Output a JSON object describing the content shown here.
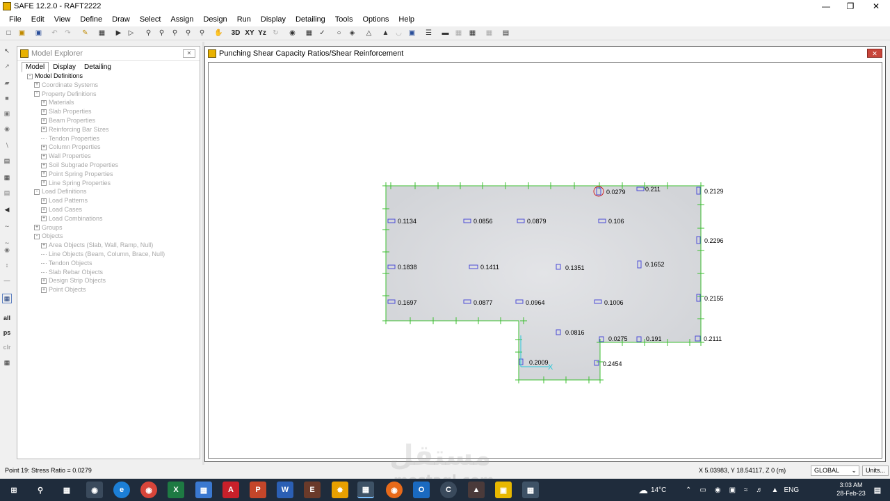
{
  "window": {
    "title": "SAFE 12.2.0 - RAFT2222",
    "minimize": "—",
    "maximize": "❐",
    "close": "✕"
  },
  "menu": [
    "File",
    "Edit",
    "View",
    "Define",
    "Draw",
    "Select",
    "Assign",
    "Design",
    "Run",
    "Display",
    "Detailing",
    "Tools",
    "Options",
    "Help"
  ],
  "toolbar": {
    "text_buttons": [
      "3D",
      "XY",
      "Yz"
    ],
    "icons": [
      "new-icon",
      "open-icon",
      "save-icon",
      "undo-icon",
      "redo-icon",
      "pencil-icon",
      "print-preview-icon",
      "run-icon",
      "run-all-icon",
      "zoom-window-icon",
      "zoom-fit-icon",
      "zoom-icon",
      "zoom-in-icon",
      "zoom-out-icon",
      "pan-icon",
      "rotate-icon",
      "view-icon",
      "check-icon",
      "circle-icon",
      "fill-icon",
      "triangle-icon",
      "tools-icon"
    ]
  },
  "left_tools": {
    "labels": [
      "all",
      "ps",
      "clr"
    ]
  },
  "explorer": {
    "title": "Model Explorer",
    "close": "✕",
    "tabs": [
      "Model",
      "Display",
      "Detailing"
    ],
    "active_tab": "Model",
    "tree": [
      {
        "label": "Model Definitions",
        "level": 0,
        "toggle": "-",
        "active": true
      },
      {
        "label": "Coordinate Systems",
        "level": 1,
        "toggle": "+"
      },
      {
        "label": "Property Definitions",
        "level": 1,
        "toggle": "-"
      },
      {
        "label": "Materials",
        "level": 2,
        "toggle": "+"
      },
      {
        "label": "Slab Properties",
        "level": 2,
        "toggle": "+"
      },
      {
        "label": "Beam Properties",
        "level": 2,
        "toggle": "+"
      },
      {
        "label": "Reinforcing Bar Sizes",
        "level": 2,
        "toggle": "+"
      },
      {
        "label": "Tendon Properties",
        "level": 2,
        "toggle": ""
      },
      {
        "label": "Column Properties",
        "level": 2,
        "toggle": "+"
      },
      {
        "label": "Wall Properties",
        "level": 2,
        "toggle": "+"
      },
      {
        "label": "Soil Subgrade Properties",
        "level": 2,
        "toggle": "+"
      },
      {
        "label": "Point Spring Properties",
        "level": 2,
        "toggle": "+"
      },
      {
        "label": "Line Spring Properties",
        "level": 2,
        "toggle": "+"
      },
      {
        "label": "Load Definitions",
        "level": 1,
        "toggle": "-"
      },
      {
        "label": "Load Patterns",
        "level": 2,
        "toggle": "+"
      },
      {
        "label": "Load Cases",
        "level": 2,
        "toggle": "+"
      },
      {
        "label": "Load Combinations",
        "level": 2,
        "toggle": "+"
      },
      {
        "label": "Groups",
        "level": 1,
        "toggle": "+"
      },
      {
        "label": "Objects",
        "level": 1,
        "toggle": "-"
      },
      {
        "label": "Area Objects (Slab, Wall, Ramp, Null)",
        "level": 2,
        "toggle": "+"
      },
      {
        "label": "Line Objects (Beam, Column, Brace, Null)",
        "level": 2,
        "toggle": ""
      },
      {
        "label": "Tendon Objects",
        "level": 2,
        "toggle": ""
      },
      {
        "label": "Slab Rebar Objects",
        "level": 2,
        "toggle": ""
      },
      {
        "label": "Design Strip Objects",
        "level": 2,
        "toggle": "+"
      },
      {
        "label": "Point Objects",
        "level": 2,
        "toggle": "+"
      }
    ]
  },
  "view": {
    "title": "Punching Shear Capacity Ratios/Shear Reinforcement",
    "close": "✕",
    "slab_fill": "#d7d9dd",
    "edge_color": "#3bbf2f",
    "column_color": "#4b4bd6",
    "axis_label": "X",
    "ratios": [
      "0.0279",
      "0.211",
      "0.2129",
      "0.1134",
      "0.0856",
      "0.0879",
      "0.106",
      "0.2296",
      "0.1838",
      "0.1411",
      "0.1351",
      "0.1652",
      "0.1697",
      "0.0877",
      "0.0964",
      "0.1006",
      "0.2155",
      "0.0816",
      "0.0275",
      "0.191",
      "0.2111",
      "0.2009",
      "0.2454"
    ]
  },
  "status": {
    "point_info": "Point 19:  Stress Ratio = 0.0279",
    "coordinates": "X 5.03983,  Y 18.54117,  Z 0  (m)",
    "coord_system": "GLOBAL",
    "units_button": "Units..."
  },
  "taskbar": {
    "apps": [
      "start-icon",
      "search-icon",
      "task-view-icon",
      "camera-icon",
      "edge-icon",
      "chrome-icon",
      "excel-icon",
      "store-icon",
      "autocad-icon",
      "powerpoint-icon",
      "word-icon",
      "etabs-icon",
      "app-icon",
      "safe-icon",
      "firefox-icon",
      "outlook-icon",
      "chrome2-icon",
      "app2-icon",
      "explorer-icon",
      "safe2-icon"
    ],
    "weather": "14°C",
    "language": "ENG",
    "time": "3:03 AM",
    "date": "28-Feb-23"
  },
  "watermark": {
    "line1": "مستقل",
    "line2": "mostaql.com"
  }
}
